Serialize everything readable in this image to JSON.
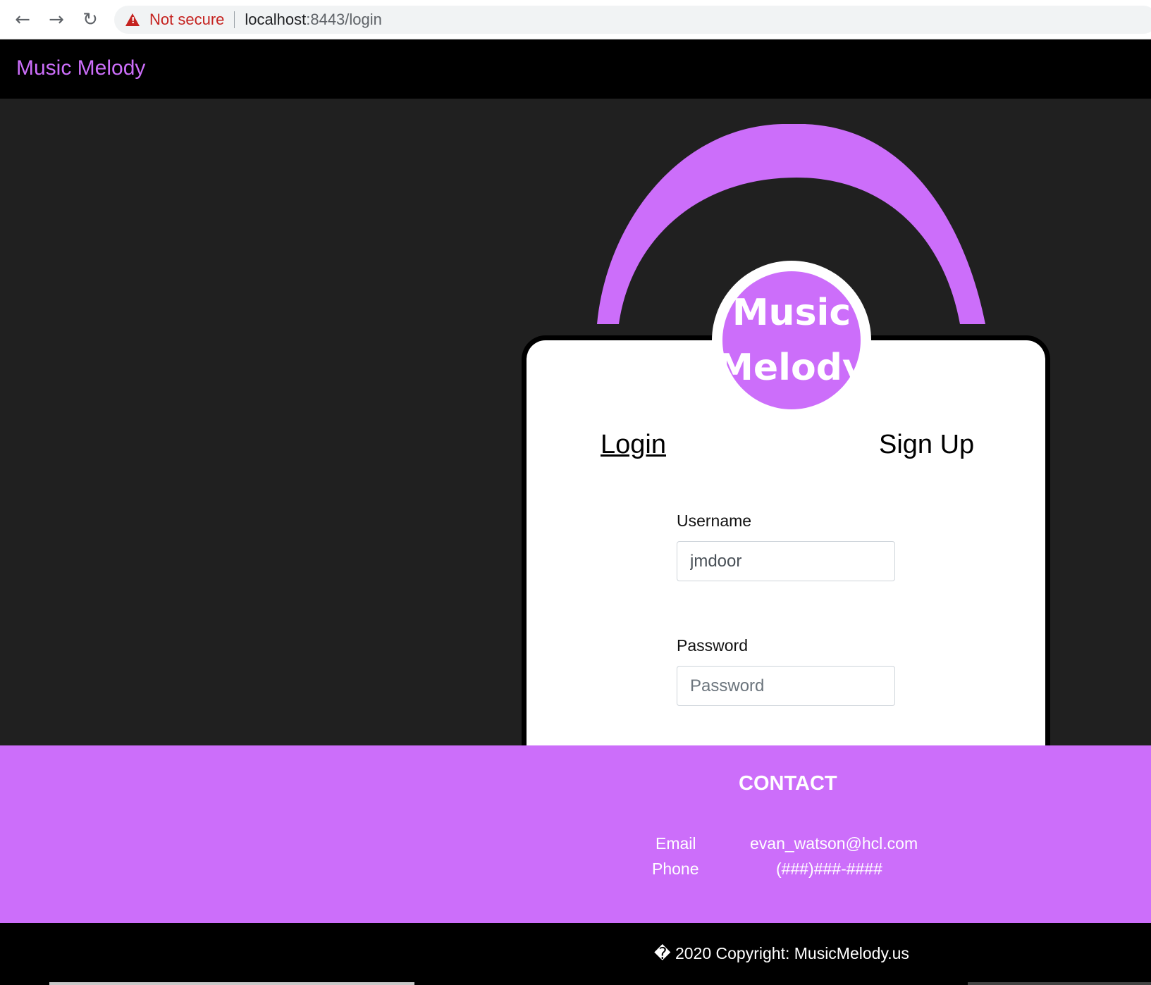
{
  "browser": {
    "security_label": "Not secure",
    "url_host": "localhost",
    "url_rest": ":8443/login"
  },
  "navbar": {
    "brand": "Music Melody"
  },
  "logo": {
    "line1": "Music",
    "line2": "Melody"
  },
  "tabs": {
    "login": "Login",
    "signup": "Sign Up"
  },
  "form": {
    "username_label": "Username",
    "username_value": "jmdoor",
    "password_label": "Password",
    "password_placeholder": "Password"
  },
  "contact": {
    "title": "CONTACT",
    "email_label": "Email",
    "email_value": "evan_watson@hcl.com",
    "phone_label": "Phone",
    "phone_value": "(###)###-####"
  },
  "footer": {
    "copyright": "� 2020 Copyright: MusicMelody.us"
  },
  "colors": {
    "accent": "#cc6efa",
    "navbar": "#000000",
    "background": "#202020"
  }
}
